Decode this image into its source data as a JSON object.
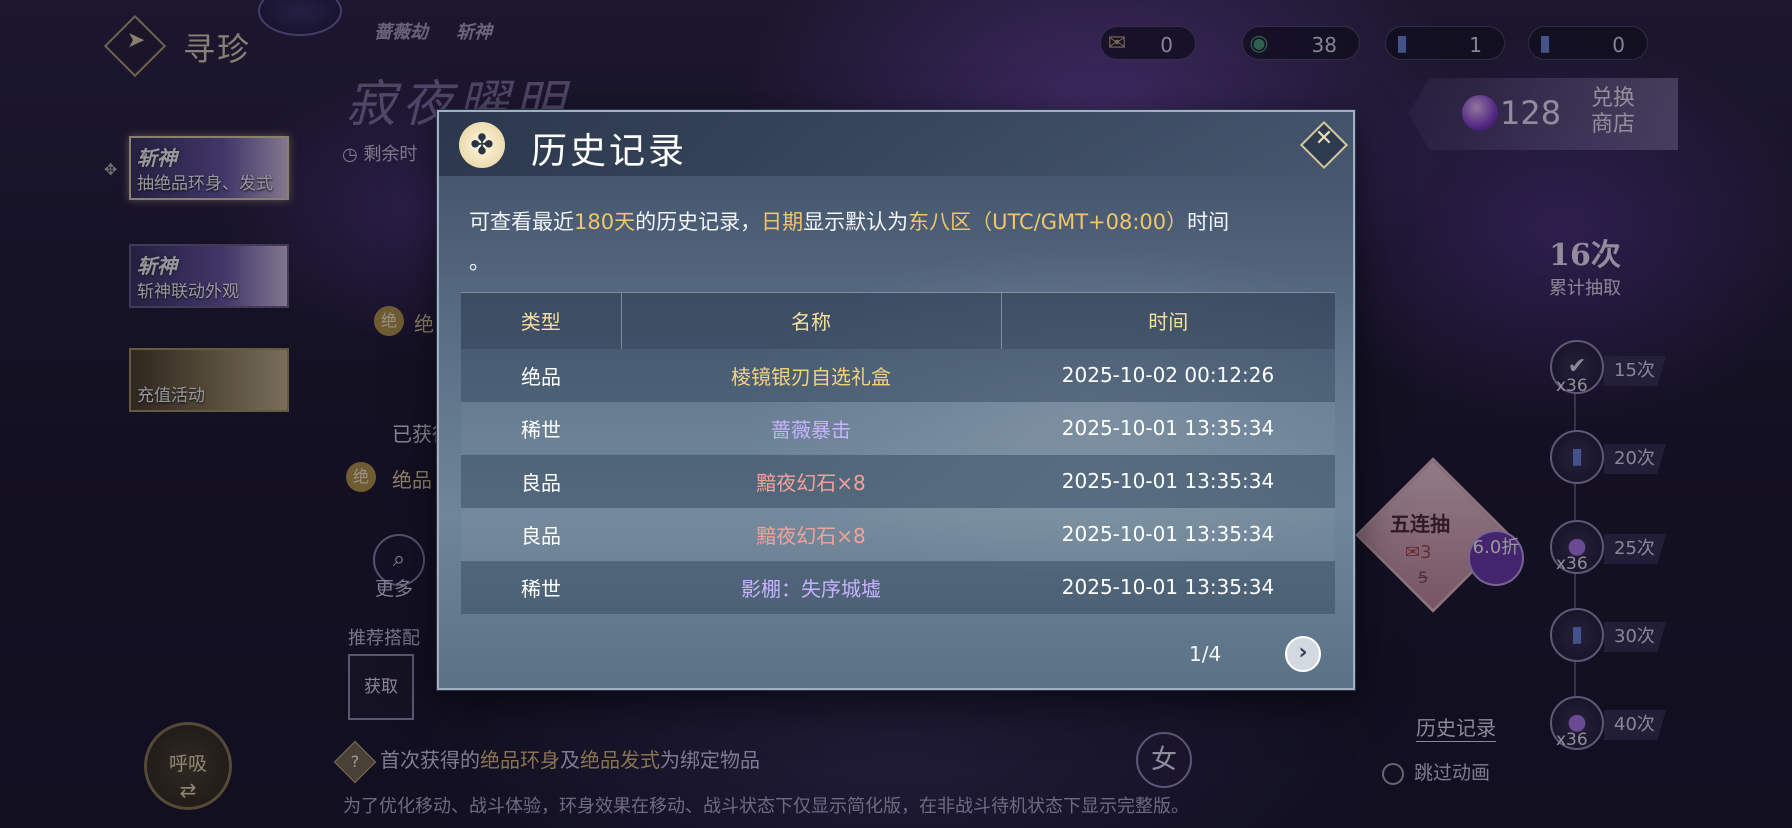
{
  "header": {
    "title": "寻珍",
    "logos": [
      "",
      "蔷薇劫",
      "斩神"
    ],
    "currencies": [
      {
        "icon": "scroll-icon",
        "value": "0",
        "color": "#c9b483"
      },
      {
        "icon": "jade-coin-icon",
        "value": "38",
        "color": "#4aa07a"
      },
      {
        "icon": "ticket-card-icon",
        "value": "1",
        "color": "#3f5fb8"
      },
      {
        "icon": "ticket-card-alt-icon",
        "value": "0",
        "color": "#3f5fb8"
      }
    ],
    "shop": {
      "value": "128",
      "label": "兑换商店"
    }
  },
  "sidebar": {
    "tabs": [
      {
        "logo": "斩神",
        "label": "抽绝品环身、发式",
        "active": true
      },
      {
        "logo": "斩神",
        "label": "斩神联动外观",
        "active": false
      },
      {
        "logo": "",
        "label": "充值活动",
        "active": false
      }
    ]
  },
  "background": {
    "banner_title": "寂夜曜明",
    "remain_label": "剩余时",
    "jue": "绝",
    "jue_text": "绝",
    "obtained": "已获得",
    "jue_text2": "绝品",
    "more": "更多",
    "recommend": "推荐搭配",
    "obtain": "获取",
    "breath": "呼吸",
    "notice_pre": "首次获得的",
    "notice_hl1": "绝品环身",
    "notice_mid": "及",
    "notice_hl2": "绝品发式",
    "notice_post": "为绑定物品",
    "footer": "为了优化移动、战斗体验，环身效果在移动、战斗状态下仅显示简化版，在非战斗待机状态下显示完整版。",
    "gender": "女"
  },
  "progress": {
    "count": "16次",
    "count_label": "累计抽取",
    "rewards": [
      {
        "icon": "check-orb-icon",
        "qty": "x36",
        "tag": "15次"
      },
      {
        "icon": "ticket-card-icon",
        "qty": "",
        "tag": "20次"
      },
      {
        "icon": "purple-orb-icon",
        "qty": "x36",
        "tag": "25次"
      },
      {
        "icon": "ticket-card-icon",
        "qty": "",
        "tag": "30次"
      },
      {
        "icon": "purple-orb-icon",
        "qty": "x36",
        "tag": "40次"
      }
    ],
    "five_pull": {
      "label": "五连抽",
      "cost": "3",
      "old_cost": "5",
      "discount": "6.0折"
    },
    "history_link": "历史记录",
    "skip_anim": "跳过动画"
  },
  "modal": {
    "title": "历史记录",
    "desc_pre": "可查看最近",
    "desc_days": "180天",
    "desc_mid": "的历史记录，",
    "desc_date": "日期",
    "desc_mid2": "显示默认为",
    "desc_zone": "东八区（UTC/GMT+08:00）",
    "desc_post": "时间",
    "desc_end": "。",
    "columns": [
      "类型",
      "名称",
      "时间"
    ],
    "rows": [
      {
        "type": "绝品",
        "name": "棱镜银刃自选礼盒",
        "time": "2025-10-02 00:12:26",
        "color": "gold"
      },
      {
        "type": "稀世",
        "name": "蔷薇暴击",
        "time": "2025-10-01 13:35:34",
        "color": "purple"
      },
      {
        "type": "良品",
        "name": "黯夜幻石×8",
        "time": "2025-10-01 13:35:34",
        "color": "red"
      },
      {
        "type": "良品",
        "name": "黯夜幻石×8",
        "time": "2025-10-01 13:35:34",
        "color": "red"
      },
      {
        "type": "稀世",
        "name": "影棚：失序城墟",
        "time": "2025-10-01 13:35:34",
        "color": "purple"
      }
    ],
    "page": "1/4"
  }
}
